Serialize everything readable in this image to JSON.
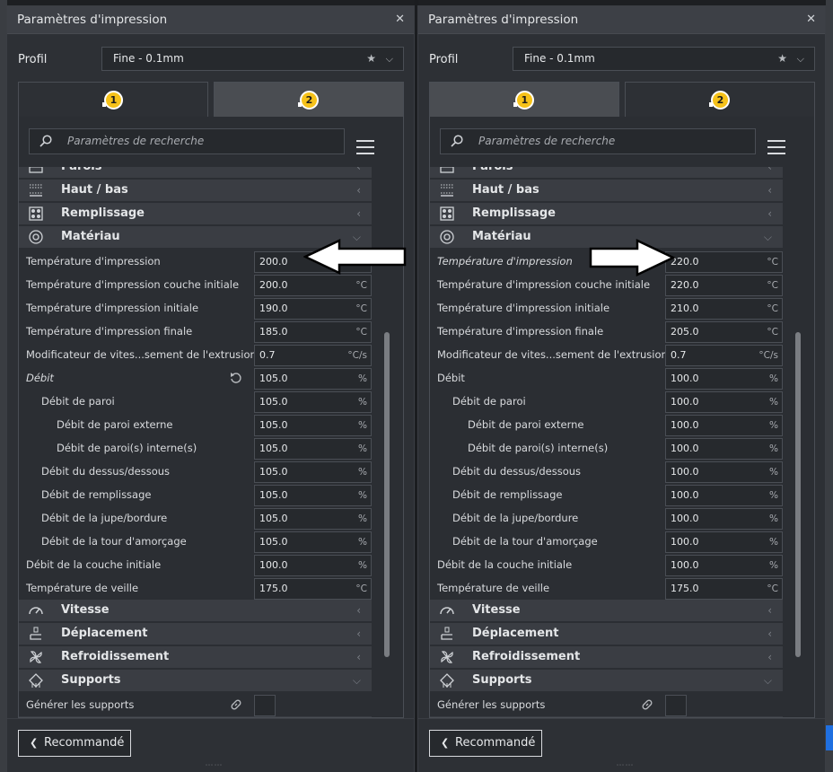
{
  "left": {
    "title": "Paramètres d'impression",
    "profile_label": "Profil",
    "profile_value": "Fine - 0.1mm",
    "tab1": "1",
    "tab2": "2",
    "search_placeholder": "Paramètres de recherche",
    "categories": {
      "parois": "Parois",
      "haut_bas": "Haut / bas",
      "remplissage": "Remplissage",
      "materiau": "Matériau",
      "vitesse": "Vitesse",
      "deplacement": "Déplacement",
      "refroidissement": "Refroidissement",
      "supports": "Supports"
    },
    "rows": [
      {
        "label": "Température d'impression",
        "value": "200.0",
        "unit": ""
      },
      {
        "label": "Température d'impression couche initiale",
        "value": "200.0",
        "unit": "°C"
      },
      {
        "label": "Température d'impression initiale",
        "value": "190.0",
        "unit": "°C"
      },
      {
        "label": "Température d'impression finale",
        "value": "185.0",
        "unit": "°C"
      },
      {
        "label": "Modificateur de vites...sement de l'extrusion",
        "value": "0.7",
        "unit": "°C/s"
      },
      {
        "label": "Débit",
        "value": "105.0",
        "unit": "%"
      },
      {
        "label": "Débit de paroi",
        "value": "105.0",
        "unit": "%"
      },
      {
        "label": "Débit de paroi externe",
        "value": "105.0",
        "unit": "%"
      },
      {
        "label": "Débit de paroi(s) interne(s)",
        "value": "105.0",
        "unit": "%"
      },
      {
        "label": "Débit du dessus/dessous",
        "value": "105.0",
        "unit": "%"
      },
      {
        "label": "Débit de remplissage",
        "value": "105.0",
        "unit": "%"
      },
      {
        "label": "Débit de la jupe/bordure",
        "value": "105.0",
        "unit": "%"
      },
      {
        "label": "Débit de la tour d'amorçage",
        "value": "105.0",
        "unit": "%"
      },
      {
        "label": "Débit de la couche initiale",
        "value": "100.0",
        "unit": "%"
      },
      {
        "label": "Température de veille",
        "value": "175.0",
        "unit": "°C"
      }
    ],
    "generate_supports": "Générer les supports",
    "recommended": "Recommandé"
  },
  "right": {
    "title": "Paramètres d'impression",
    "profile_label": "Profil",
    "profile_value": "Fine - 0.1mm",
    "tab1": "1",
    "tab2": "2",
    "search_placeholder": "Paramètres de recherche",
    "categories": {
      "parois": "Parois",
      "haut_bas": "Haut / bas",
      "remplissage": "Remplissage",
      "materiau": "Matériau",
      "vitesse": "Vitesse",
      "deplacement": "Déplacement",
      "refroidissement": "Refroidissement",
      "supports": "Supports"
    },
    "rows": [
      {
        "label": "Température d'impression",
        "value": "220.0",
        "unit": "°C"
      },
      {
        "label": "Température d'impression couche initiale",
        "value": "220.0",
        "unit": "°C"
      },
      {
        "label": "Température d'impression initiale",
        "value": "210.0",
        "unit": "°C"
      },
      {
        "label": "Température d'impression finale",
        "value": "205.0",
        "unit": "°C"
      },
      {
        "label": "Modificateur de vites...sement de l'extrusion",
        "value": "0.7",
        "unit": "°C/s"
      },
      {
        "label": "Débit",
        "value": "100.0",
        "unit": "%"
      },
      {
        "label": "Débit de paroi",
        "value": "100.0",
        "unit": "%"
      },
      {
        "label": "Débit de paroi externe",
        "value": "100.0",
        "unit": "%"
      },
      {
        "label": "Débit de paroi(s) interne(s)",
        "value": "100.0",
        "unit": "%"
      },
      {
        "label": "Débit du dessus/dessous",
        "value": "100.0",
        "unit": "%"
      },
      {
        "label": "Débit de remplissage",
        "value": "100.0",
        "unit": "%"
      },
      {
        "label": "Débit de la jupe/bordure",
        "value": "100.0",
        "unit": "%"
      },
      {
        "label": "Débit de la tour d'amorçage",
        "value": "100.0",
        "unit": "%"
      },
      {
        "label": "Débit de la couche initiale",
        "value": "100.0",
        "unit": "%"
      },
      {
        "label": "Température de veille",
        "value": "175.0",
        "unit": "°C"
      }
    ],
    "generate_supports": "Générer les supports",
    "recommended": "Recommandé"
  },
  "colors": {
    "badge": "#f6c21a",
    "panel": "#2d3035",
    "category": "#3a3d43"
  },
  "icons": [
    "close-icon",
    "star-icon",
    "chevron-down-icon",
    "search-icon",
    "menu-icon",
    "reset-icon",
    "link-icon",
    "chevron-left-icon",
    "arrow-icon"
  ]
}
